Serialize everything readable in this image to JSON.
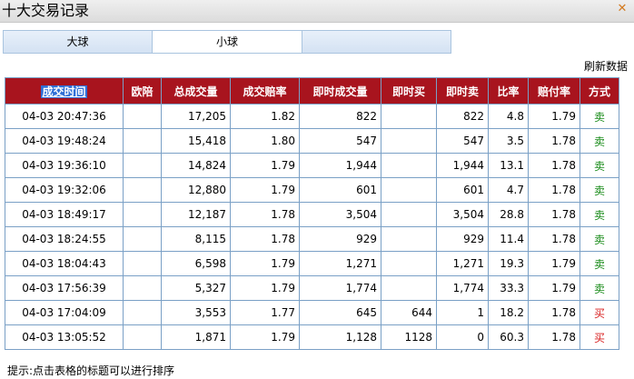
{
  "window": {
    "title": "十大交易记录",
    "close_icon": "close-icon"
  },
  "tabs": [
    {
      "label": "大球",
      "selected": false
    },
    {
      "label": "小球",
      "selected": true
    },
    {
      "label": "",
      "selected": false
    }
  ],
  "refresh_label": "刷新数据",
  "table": {
    "columns": [
      "成交时间",
      "欧陪",
      "总成交量",
      "成交赔率",
      "即时成交量",
      "即时买",
      "即时卖",
      "比率",
      "赔付率",
      "方式"
    ],
    "sorted_column": "成交时间",
    "rows": [
      {
        "time": "04-03 20:47:36",
        "odds": "",
        "total": "17,205",
        "rate": "1.82",
        "instant": "822",
        "buy": "",
        "sell": "822",
        "ratio": "4.8",
        "payout": "1.79",
        "way": "卖",
        "way_type": "sell"
      },
      {
        "time": "04-03 19:48:24",
        "odds": "",
        "total": "15,418",
        "rate": "1.80",
        "instant": "547",
        "buy": "",
        "sell": "547",
        "ratio": "3.5",
        "payout": "1.78",
        "way": "卖",
        "way_type": "sell"
      },
      {
        "time": "04-03 19:36:10",
        "odds": "",
        "total": "14,824",
        "rate": "1.79",
        "instant": "1,944",
        "buy": "",
        "sell": "1,944",
        "ratio": "13.1",
        "payout": "1.78",
        "way": "卖",
        "way_type": "sell"
      },
      {
        "time": "04-03 19:32:06",
        "odds": "",
        "total": "12,880",
        "rate": "1.79",
        "instant": "601",
        "buy": "",
        "sell": "601",
        "ratio": "4.7",
        "payout": "1.78",
        "way": "卖",
        "way_type": "sell"
      },
      {
        "time": "04-03 18:49:17",
        "odds": "",
        "total": "12,187",
        "rate": "1.78",
        "instant": "3,504",
        "buy": "",
        "sell": "3,504",
        "ratio": "28.8",
        "payout": "1.78",
        "way": "卖",
        "way_type": "sell"
      },
      {
        "time": "04-03 18:24:55",
        "odds": "",
        "total": "8,115",
        "rate": "1.78",
        "instant": "929",
        "buy": "",
        "sell": "929",
        "ratio": "11.4",
        "payout": "1.78",
        "way": "卖",
        "way_type": "sell"
      },
      {
        "time": "04-03 18:04:43",
        "odds": "",
        "total": "6,598",
        "rate": "1.79",
        "instant": "1,271",
        "buy": "",
        "sell": "1,271",
        "ratio": "19.3",
        "payout": "1.79",
        "way": "卖",
        "way_type": "sell"
      },
      {
        "time": "04-03 17:56:39",
        "odds": "",
        "total": "5,327",
        "rate": "1.79",
        "instant": "1,774",
        "buy": "",
        "sell": "1,774",
        "ratio": "33.3",
        "payout": "1.79",
        "way": "卖",
        "way_type": "sell"
      },
      {
        "time": "04-03 17:04:09",
        "odds": "",
        "total": "3,553",
        "rate": "1.77",
        "instant": "645",
        "buy": "644",
        "sell": "1",
        "ratio": "18.2",
        "payout": "1.78",
        "way": "买",
        "way_type": "buy"
      },
      {
        "time": "04-03 13:05:52",
        "odds": "",
        "total": "1,871",
        "rate": "1.79",
        "instant": "1,128",
        "buy": "1128",
        "sell": "0",
        "ratio": "60.3",
        "payout": "1.78",
        "way": "买",
        "way_type": "buy"
      }
    ]
  },
  "hint": "提示:点击表格的标题可以进行排序",
  "colors": {
    "header_bg": "#a8141e",
    "sell": "#178a17",
    "buy": "#d82020",
    "border": "#7aa0c6"
  }
}
